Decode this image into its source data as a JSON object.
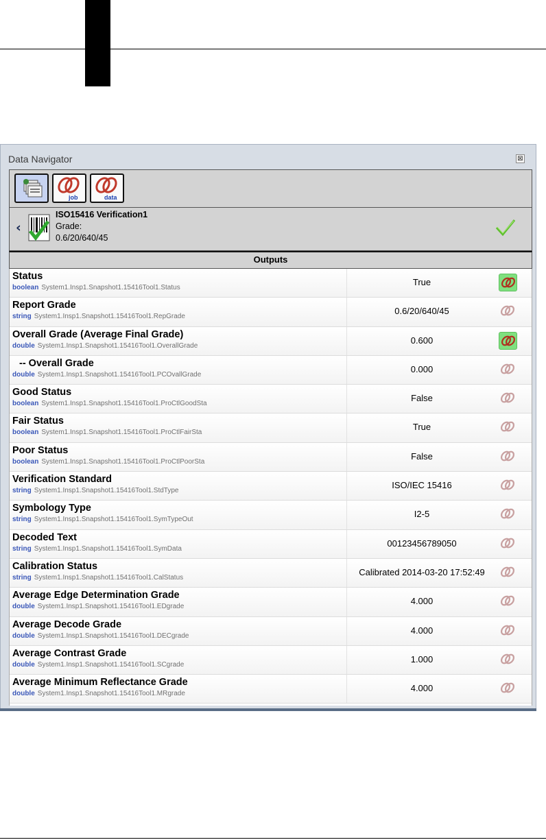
{
  "panel": {
    "title": "Data Navigator",
    "close_glyph": "⊠"
  },
  "toolbar": {
    "buttons": [
      {
        "name": "tools-icon",
        "label": "",
        "active": true
      },
      {
        "name": "job-link-icon",
        "label": "job",
        "active": false
      },
      {
        "name": "data-link-icon",
        "label": "data",
        "active": false
      }
    ]
  },
  "tool": {
    "name": "ISO15416 Verification1",
    "grade_label": "Grade:",
    "grade_value": "0.6/20/640/45",
    "status_icon": "green-checkmark-icon"
  },
  "outputs": {
    "header": "Outputs",
    "rows": [
      {
        "name": "Status",
        "type": "boolean",
        "path": "System1.Insp1.Snapshot1.15416Tool1.Status",
        "value": "True",
        "linked": true
      },
      {
        "name": "Report Grade",
        "type": "string",
        "path": "System1.Insp1.Snapshot1.15416Tool1.RepGrade",
        "value": "0.6/20/640/45",
        "linked": false
      },
      {
        "name": "Overall Grade (Average Final Grade)",
        "type": "double",
        "path": "System1.Insp1.Snapshot1.15416Tool1.OverallGrade",
        "value": "0.600",
        "linked": true
      },
      {
        "name": "-- Overall Grade",
        "type": "double",
        "path": "System1.Insp1.Snapshot1.15416Tool1.PCOvallGrade",
        "value": "0.000",
        "linked": false,
        "indent": true
      },
      {
        "name": "Good Status",
        "type": "boolean",
        "path": "System1.Insp1.Snapshot1.15416Tool1.ProCtlGoodSta",
        "value": "False",
        "linked": false
      },
      {
        "name": "Fair Status",
        "type": "boolean",
        "path": "System1.Insp1.Snapshot1.15416Tool1.ProCtlFairSta",
        "value": "True",
        "linked": false
      },
      {
        "name": "Poor Status",
        "type": "boolean",
        "path": "System1.Insp1.Snapshot1.15416Tool1.ProCtlPoorSta",
        "value": "False",
        "linked": false
      },
      {
        "name": "Verification Standard",
        "type": "string",
        "path": "System1.Insp1.Snapshot1.15416Tool1.StdType",
        "value": "ISO/IEC 15416",
        "linked": false
      },
      {
        "name": "Symbology Type",
        "type": "string",
        "path": "System1.Insp1.Snapshot1.15416Tool1.SymTypeOut",
        "value": "I2-5",
        "linked": false
      },
      {
        "name": "Decoded Text",
        "type": "string",
        "path": "System1.Insp1.Snapshot1.15416Tool1.SymData",
        "value": "00123456789050",
        "linked": false
      },
      {
        "name": "Calibration Status",
        "type": "string",
        "path": "System1.Insp1.Snapshot1.15416Tool1.CalStatus",
        "value": "Calibrated 2014-03-20 17:52:49",
        "linked": false
      },
      {
        "name": "Average Edge Determination Grade",
        "type": "double",
        "path": "System1.Insp1.Snapshot1.15416Tool1.EDgrade",
        "value": "4.000",
        "linked": false
      },
      {
        "name": "Average Decode Grade",
        "type": "double",
        "path": "System1.Insp1.Snapshot1.15416Tool1.DECgrade",
        "value": "4.000",
        "linked": false
      },
      {
        "name": "Average Contrast Grade",
        "type": "double",
        "path": "System1.Insp1.Snapshot1.15416Tool1.SCgrade",
        "value": "1.000",
        "linked": false
      },
      {
        "name": "Average Minimum Reflectance Grade",
        "type": "double",
        "path": "System1.Insp1.Snapshot1.15416Tool1.MRgrade",
        "value": "4.000",
        "linked": false
      }
    ]
  },
  "colors": {
    "type_label": "#3a57b8",
    "link_active_bg": "#7fe07f",
    "link_chain": "#c0392b",
    "panel_bg": "#d7dde5"
  }
}
